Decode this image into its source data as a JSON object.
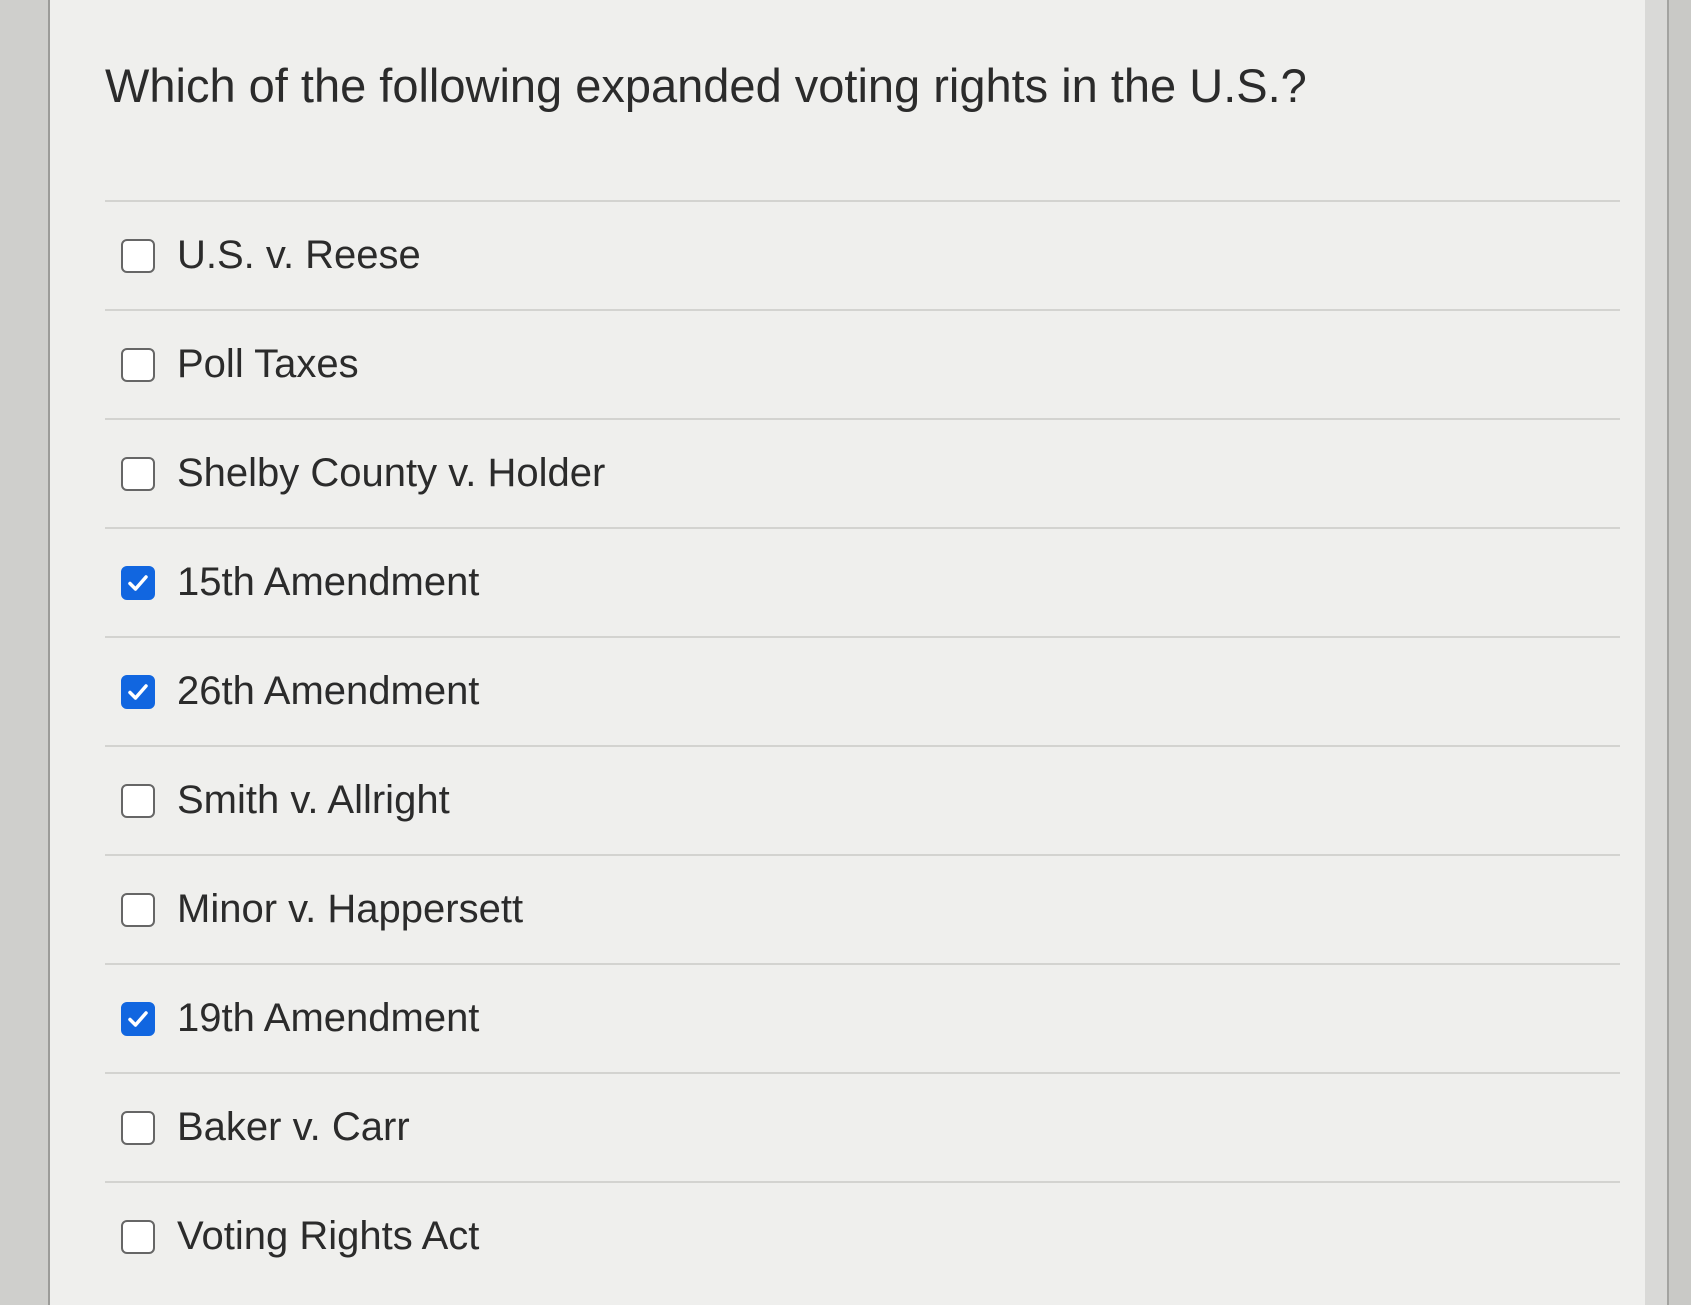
{
  "question": {
    "text": "Which of the following expanded voting rights in the U.S.?"
  },
  "options": [
    {
      "label": "U.S. v. Reese",
      "checked": false
    },
    {
      "label": "Poll Taxes",
      "checked": false
    },
    {
      "label": "Shelby County v. Holder",
      "checked": false
    },
    {
      "label": "15th Amendment",
      "checked": true
    },
    {
      "label": "26th Amendment",
      "checked": true
    },
    {
      "label": "Smith v. Allright",
      "checked": false
    },
    {
      "label": "Minor v. Happersett",
      "checked": false
    },
    {
      "label": "19th Amendment",
      "checked": true
    },
    {
      "label": "Baker v. Carr",
      "checked": false
    },
    {
      "label": "Voting Rights Act",
      "checked": false
    }
  ],
  "colors": {
    "checkbox_checked": "#1166e0",
    "text": "#2b2b2b",
    "divider": "#d3d3d0"
  }
}
